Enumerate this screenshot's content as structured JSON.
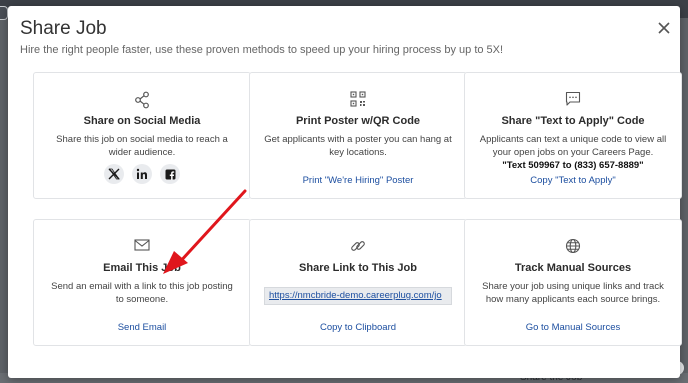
{
  "modal": {
    "title": "Share Job",
    "subtitle": "Hire the right people faster, use these proven methods to speed up your hiring process by up to 5X!"
  },
  "cards": {
    "social": {
      "icon": "share-icon",
      "title": "Share on Social Media",
      "desc": "Share this job on social media to reach a wider audience.",
      "buttons": [
        "x-icon",
        "linkedin-icon",
        "facebook-icon"
      ]
    },
    "poster": {
      "icon": "qr-code-icon",
      "title": "Print Poster w/QR Code",
      "desc": "Get applicants with a poster you can hang at key locations.",
      "link": "Print \"We're Hiring\" Poster"
    },
    "text_apply": {
      "icon": "chat-icon",
      "title": "Share \"Text to Apply\" Code",
      "desc": "Applicants can text a unique code to view all your open jobs on your Careers Page.",
      "code": "\"Text 509967 to (833) 657-8889\"",
      "link": "Copy \"Text to Apply\""
    },
    "email": {
      "icon": "envelope-icon",
      "title": "Email This Job",
      "desc": "Send an email with a link to this job posting to someone.",
      "link": "Send Email"
    },
    "share_link": {
      "icon": "link-icon",
      "title": "Share Link to This Job",
      "url": "https://nmcbride-demo.careerplug.com/jo",
      "link": "Copy to Clipboard"
    },
    "manual_sources": {
      "icon": "globe-icon",
      "title": "Track Manual Sources",
      "desc": "Share your job using unique links and track how many applicants each source brings.",
      "link": "Go to Manual Sources"
    }
  },
  "background": {
    "bottom_text": "Share the Job"
  },
  "colors": {
    "link": "#1d4fa0",
    "annotation_arrow": "#e0161c",
    "card_border": "#e1e3e6"
  }
}
